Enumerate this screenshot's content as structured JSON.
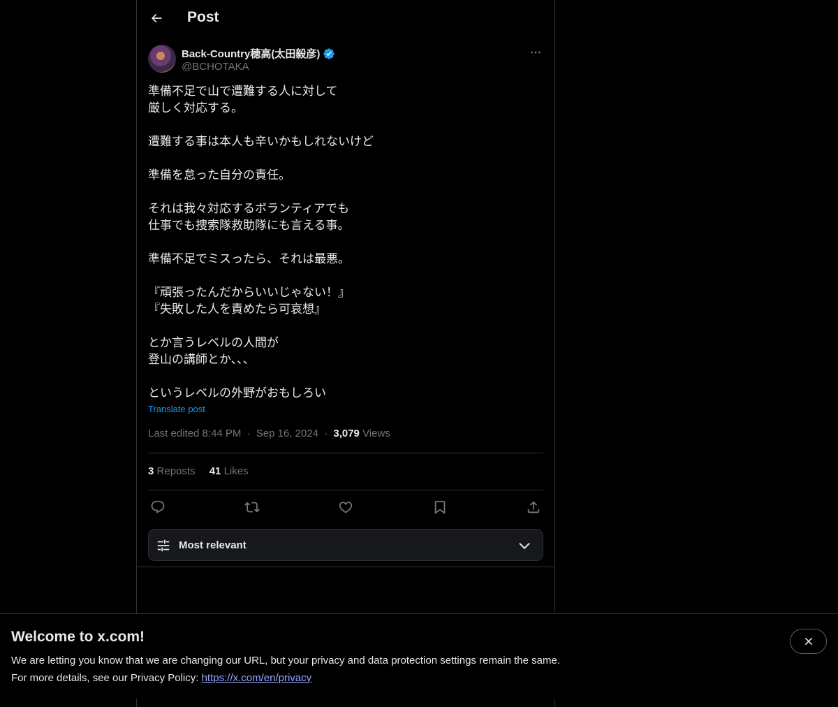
{
  "header": {
    "title": "Post"
  },
  "author": {
    "display_name": "Back-Country穂高(太田毅彦)",
    "handle": "@BCHOTAKA",
    "verified": true
  },
  "post": {
    "text": "準備不足で山で遭難する人に対して\n厳しく対応する。\n\n遭難する事は本人も辛いかもしれないけど\n\n準備を怠った自分の責任。\n\nそれは我々対応するボランティアでも\n仕事でも捜索隊救助隊にも言える事。\n\n準備不足でミスったら、それは最悪。\n\n『頑張ったんだからいいじゃない！』\n『失敗した人を責めたら可哀想』\n\nとか言うレベルの人間が\n登山の講師とか、、、\n\nというレベルの外野がおもしろい",
    "translate_label": "Translate post",
    "edited_label": "Last edited 8:44 PM",
    "date": "Sep 16, 2024",
    "separator": "·",
    "views_count": "3,079",
    "views_label": "Views"
  },
  "stats": {
    "reposts_count": "3",
    "reposts_label": "Reposts",
    "likes_count": "41",
    "likes_label": "Likes"
  },
  "actions": [
    "reply-icon",
    "repost-icon",
    "like-icon",
    "bookmark-icon",
    "share-icon"
  ],
  "sort": {
    "label": "Most relevant"
  },
  "banner": {
    "title": "Welcome to x.com!",
    "line1": "We are letting you know that we are changing our URL, but your privacy and data protection settings remain the same.",
    "line2_prefix": "For more details, see our Privacy Policy: ",
    "link": "https://x.com/en/privacy"
  },
  "colors": {
    "background": "#000000",
    "text": "#e7e9ea",
    "muted": "#71767b",
    "accent": "#1d9bf0",
    "border": "#2f3336",
    "banner_link": "#9ba6ff"
  }
}
